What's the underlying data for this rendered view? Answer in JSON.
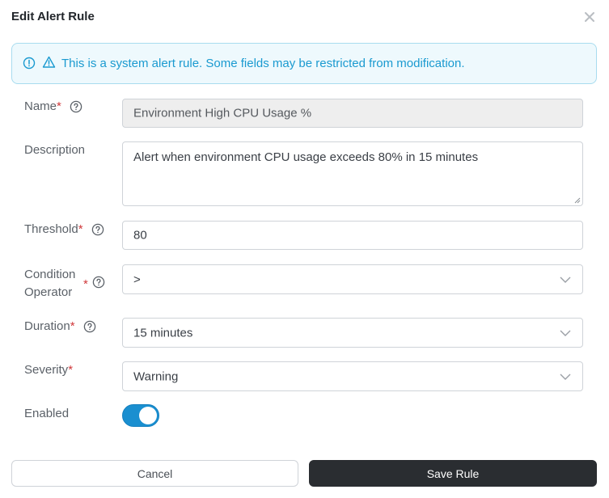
{
  "dialog": {
    "title": "Edit Alert Rule",
    "close_icon": "close-icon"
  },
  "banner": {
    "text": "This is a system alert rule. Some fields may be restricted from modification.",
    "icons": [
      "info-icon",
      "warning-icon"
    ],
    "color": "#1a9ad0"
  },
  "form": {
    "name": {
      "label": "Name",
      "required": "*",
      "value": "Environment High CPU Usage %",
      "disabled": true
    },
    "description": {
      "label": "Description",
      "value": "Alert when environment CPU usage exceeds 80% in 15 minutes"
    },
    "threshold": {
      "label": "Threshold",
      "required": "*",
      "value": "80"
    },
    "condition_operator": {
      "label_line1": "Condition",
      "label_line2": "Operator",
      "required": "*",
      "value": ">"
    },
    "duration": {
      "label": "Duration",
      "required": "*",
      "value": "15 minutes"
    },
    "severity": {
      "label": "Severity",
      "required": "*",
      "value": "Warning"
    },
    "enabled": {
      "label": "Enabled",
      "on": true
    }
  },
  "buttons": {
    "cancel": "Cancel",
    "save": "Save Rule"
  },
  "colors": {
    "required": "#d0393b",
    "toggle_on": "#1a8fd0",
    "primary_button": "#2a2d31"
  }
}
